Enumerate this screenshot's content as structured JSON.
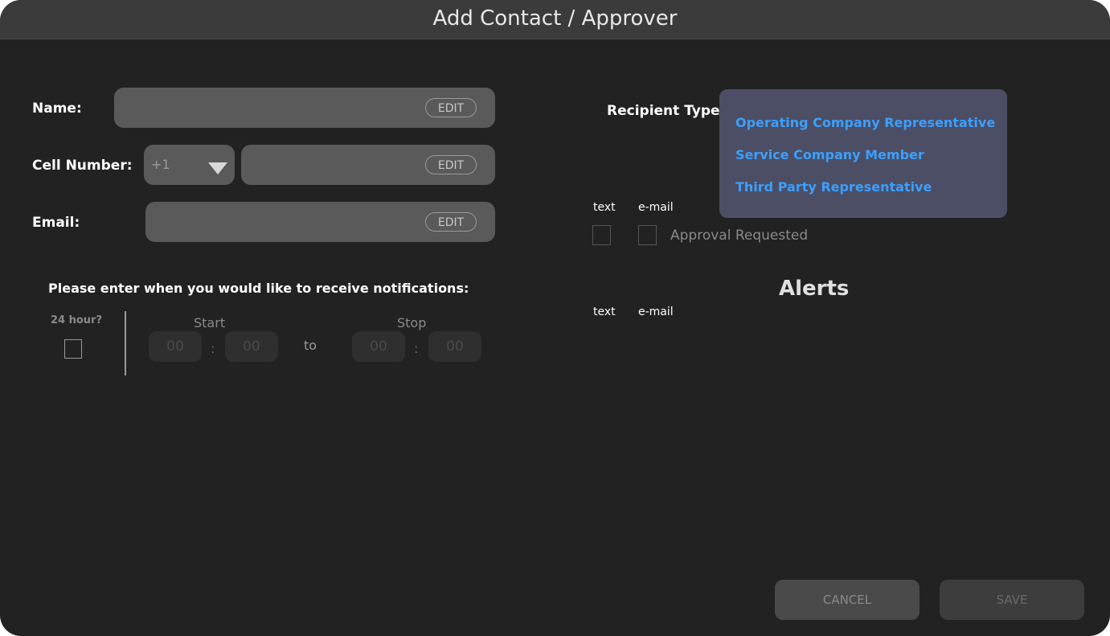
{
  "window": {
    "title": "Add Contact / Approver"
  },
  "form": {
    "name_label": "Name:",
    "cell_label": "Cell Number:",
    "country_code": "+1",
    "email_label": "Email:",
    "edit_label": "EDIT"
  },
  "notifications": {
    "prompt": "Please enter when you would like to receive notifications:",
    "hour24_label": "24 hour?",
    "start_label": "Start",
    "stop_label": "Stop",
    "to_label": "to",
    "start_hour": "00",
    "start_min": "00",
    "stop_hour": "00",
    "stop_min": "00",
    "colon": ":"
  },
  "recipient": {
    "label": "Recipient Type:",
    "options": [
      "Operating Company Representative",
      "Service Company Member",
      "Third Party Representative"
    ],
    "text_header": "text",
    "email_header": "e-mail",
    "approval_label": "Approval Requested"
  },
  "alerts": {
    "title": "Alerts",
    "text_header": "text",
    "email_header": "e-mail"
  },
  "footer": {
    "cancel_label": "CANCEL",
    "save_label": "SAVE"
  },
  "colors": {
    "background": "#222222",
    "field": "#5a5a5a",
    "dropdown_bg": "#4c4e66",
    "link_blue": "#3aa0ff"
  },
  "icons": {
    "country_dropdown": "triangle-down-icon"
  }
}
